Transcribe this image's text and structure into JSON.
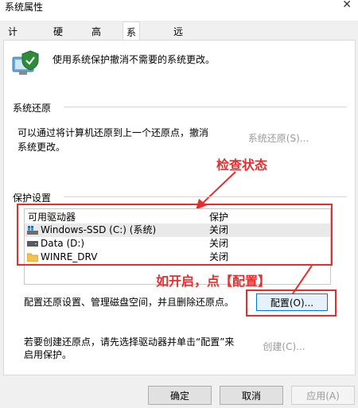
{
  "window": {
    "title": "系统属性",
    "close_glyph": "✕"
  },
  "tabs": [
    {
      "label": "计算机名"
    },
    {
      "label": "硬件"
    },
    {
      "label": "高级"
    },
    {
      "label": "系统保护",
      "active": true
    },
    {
      "label": "远程"
    }
  ],
  "intro": {
    "text": "使用系统保护撤消不需要的系统更改。",
    "icon": "system-protect-icon"
  },
  "restore": {
    "section_label": "系统还原",
    "description_line1": "可以通过将计算机还原到上一个还原点，撤消",
    "description_line2": "系统更改。",
    "button_label": "系统还原(S)..."
  },
  "protection": {
    "section_label": "保护设置",
    "columns": {
      "drive": "可用驱动器",
      "status": "保护"
    },
    "drives": [
      {
        "name": "Windows-SSD (C:) (系统)",
        "status": "关闭",
        "icon": "windows-drive-icon"
      },
      {
        "name": "Data (D:)",
        "status": "关闭",
        "icon": "drive-icon"
      },
      {
        "name": "WINRE_DRV",
        "status": "关闭",
        "icon": "folder-icon"
      }
    ],
    "configure_text": "配置还原设置、管理磁盘空间，并且删除还原点。",
    "configure_button": "配置(O)...",
    "create_text_line1": "若要创建还原点，请先选择驱动器并单击“配置”来",
    "create_text_line2": "启用保护。",
    "create_button": "创建(C)..."
  },
  "annotations": {
    "check_status": "检查状态",
    "open_hint": "如开启，点【配置】"
  },
  "footer": {
    "ok": "确定",
    "cancel": "取消",
    "apply": "应用(A)"
  },
  "colors": {
    "annotation": "#e62e2e",
    "accent": "#0078d7"
  }
}
